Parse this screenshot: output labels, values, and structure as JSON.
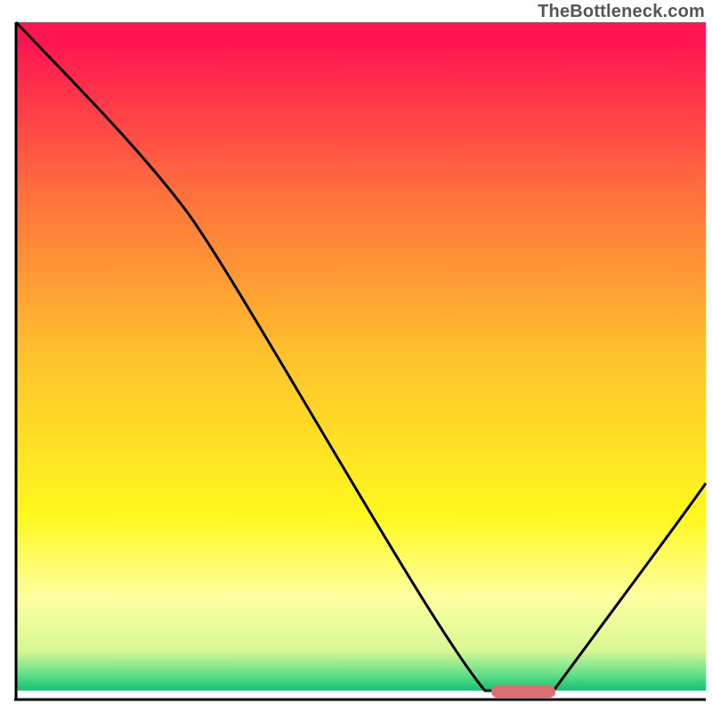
{
  "watermark": "TheBottleneck.com",
  "chart_data": {
    "type": "line",
    "title": "",
    "xlabel": "",
    "ylabel": "",
    "xlim": [
      0,
      100
    ],
    "ylim": [
      0,
      100
    ],
    "grid": false,
    "legend": false,
    "series": [
      {
        "name": "bottleneck-curve",
        "x": [
          0,
          24,
          68,
          78,
          100
        ],
        "values": [
          100,
          73,
          1,
          1,
          32
        ],
        "color": "#000000"
      }
    ],
    "marker": {
      "name": "optimal-range",
      "x_start": 69,
      "x_end": 78,
      "y": 1,
      "color": "#db6e72"
    },
    "background_gradient": {
      "type": "vertical",
      "stops": [
        {
          "offset": 0.03,
          "color": "#ff1650"
        },
        {
          "offset": 0.25,
          "color": "#ff6f3e"
        },
        {
          "offset": 0.5,
          "color": "#ffc42c"
        },
        {
          "offset": 0.73,
          "color": "#fff81d"
        },
        {
          "offset": 0.85,
          "color": "#ffffa0"
        },
        {
          "offset": 0.93,
          "color": "#d7f894"
        },
        {
          "offset": 0.965,
          "color": "#64e08a"
        },
        {
          "offset": 0.985,
          "color": "#1fc876"
        }
      ]
    },
    "axes_visible": false,
    "frame": {
      "left": true,
      "bottom": true,
      "color": "#000000",
      "width": 3
    }
  }
}
